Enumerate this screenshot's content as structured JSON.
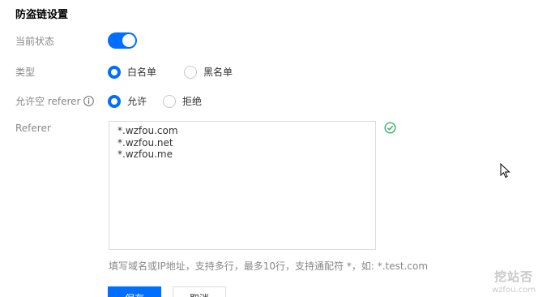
{
  "section": {
    "title": "防盗链设置"
  },
  "status": {
    "label": "当前状态",
    "enabled": true
  },
  "type": {
    "label": "类型",
    "options": [
      "白名单",
      "黑名单"
    ],
    "selected": "白名单"
  },
  "allow_empty_referer": {
    "label": "允许空 referer",
    "options": [
      "允许",
      "拒绝"
    ],
    "selected": "允许"
  },
  "referer": {
    "label": "Referer",
    "value": "*.wzfou.com\n*.wzfou.net\n*.wzfou.me",
    "hint": "填写域名或IP地址，支持多行，最多10行，支持通配符 *，如: *.test.com",
    "valid_icon": "check-circle-icon"
  },
  "buttons": {
    "save_label": "保存",
    "cancel_label": "取消"
  },
  "watermark": {
    "text_cn": "挖站否",
    "text_en": "wzfou.com"
  },
  "colors": {
    "accent": "#006eff",
    "success": "#34b264"
  }
}
